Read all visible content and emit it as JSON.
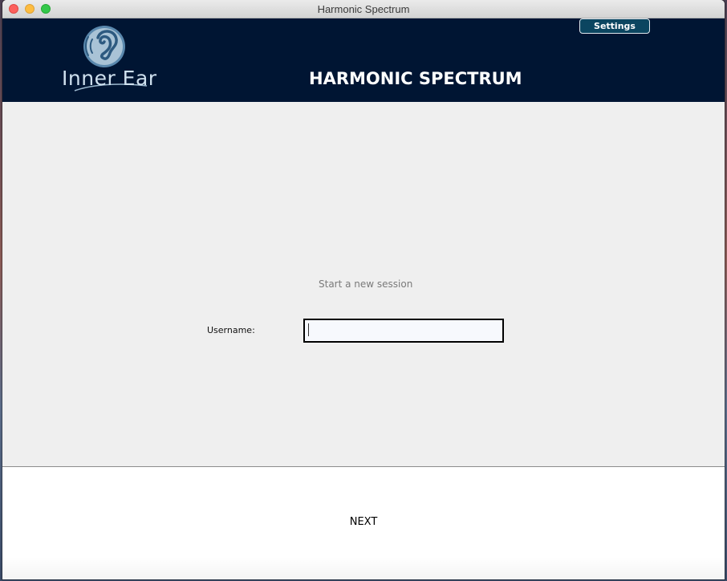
{
  "window": {
    "title": "Harmonic Spectrum"
  },
  "header": {
    "logo_text": "Inner Ear",
    "settings_label": "Settings",
    "page_title": "HARMONIC SPECTRUM",
    "background_color": "#001533",
    "settings_color": "#0b4560"
  },
  "main": {
    "session_label": "Start a new session",
    "username_label": "Username:",
    "username_value": ""
  },
  "footer": {
    "next_label": "NEXT"
  },
  "icons": {
    "logo": "ear-logo-icon",
    "close": "close-icon",
    "minimize": "minimize-icon",
    "maximize": "maximize-icon"
  }
}
